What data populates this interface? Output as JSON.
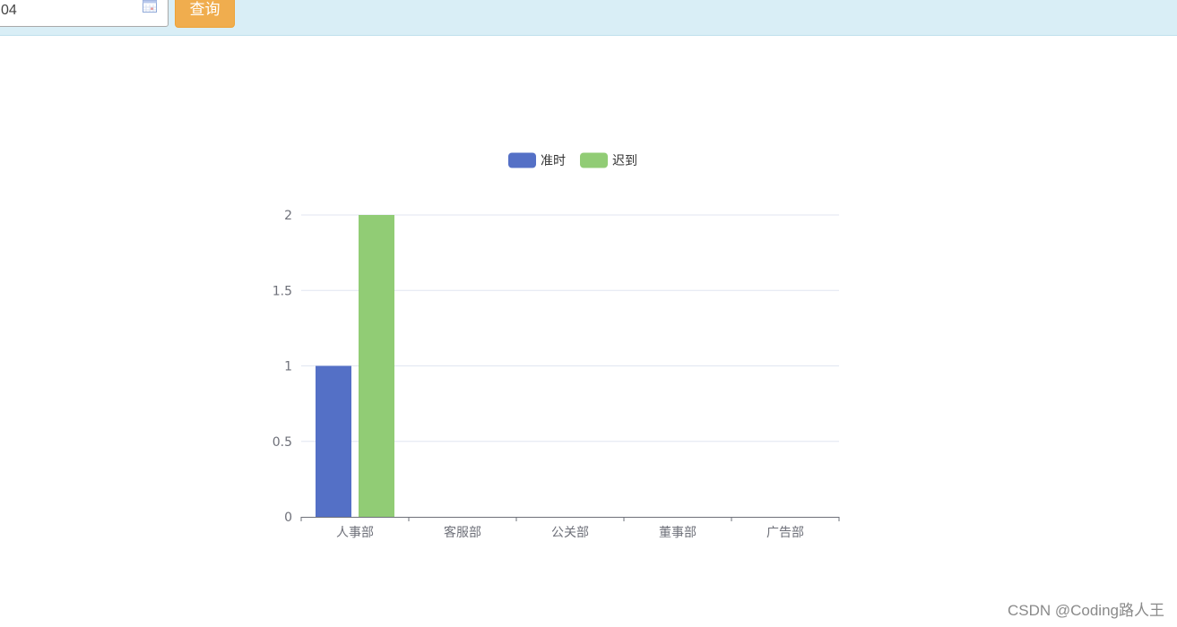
{
  "toolbar": {
    "date_value": "04",
    "query_label": "查询"
  },
  "chart_data": {
    "type": "bar",
    "categories": [
      "人事部",
      "客服部",
      "公关部",
      "董事部",
      "广告部"
    ],
    "series": [
      {
        "name": "准时",
        "values": [
          1,
          0,
          0,
          0,
          0
        ],
        "color": "#5470c6"
      },
      {
        "name": "迟到",
        "values": [
          2,
          0,
          0,
          0,
          0
        ],
        "color": "#91cc75"
      }
    ],
    "ylim": [
      0,
      2
    ],
    "yticks": [
      "0",
      "0.5",
      "1",
      "1.5",
      "2"
    ],
    "legend_position": "top-center",
    "grid": true
  },
  "watermark": "CSDN @Coding路人王"
}
